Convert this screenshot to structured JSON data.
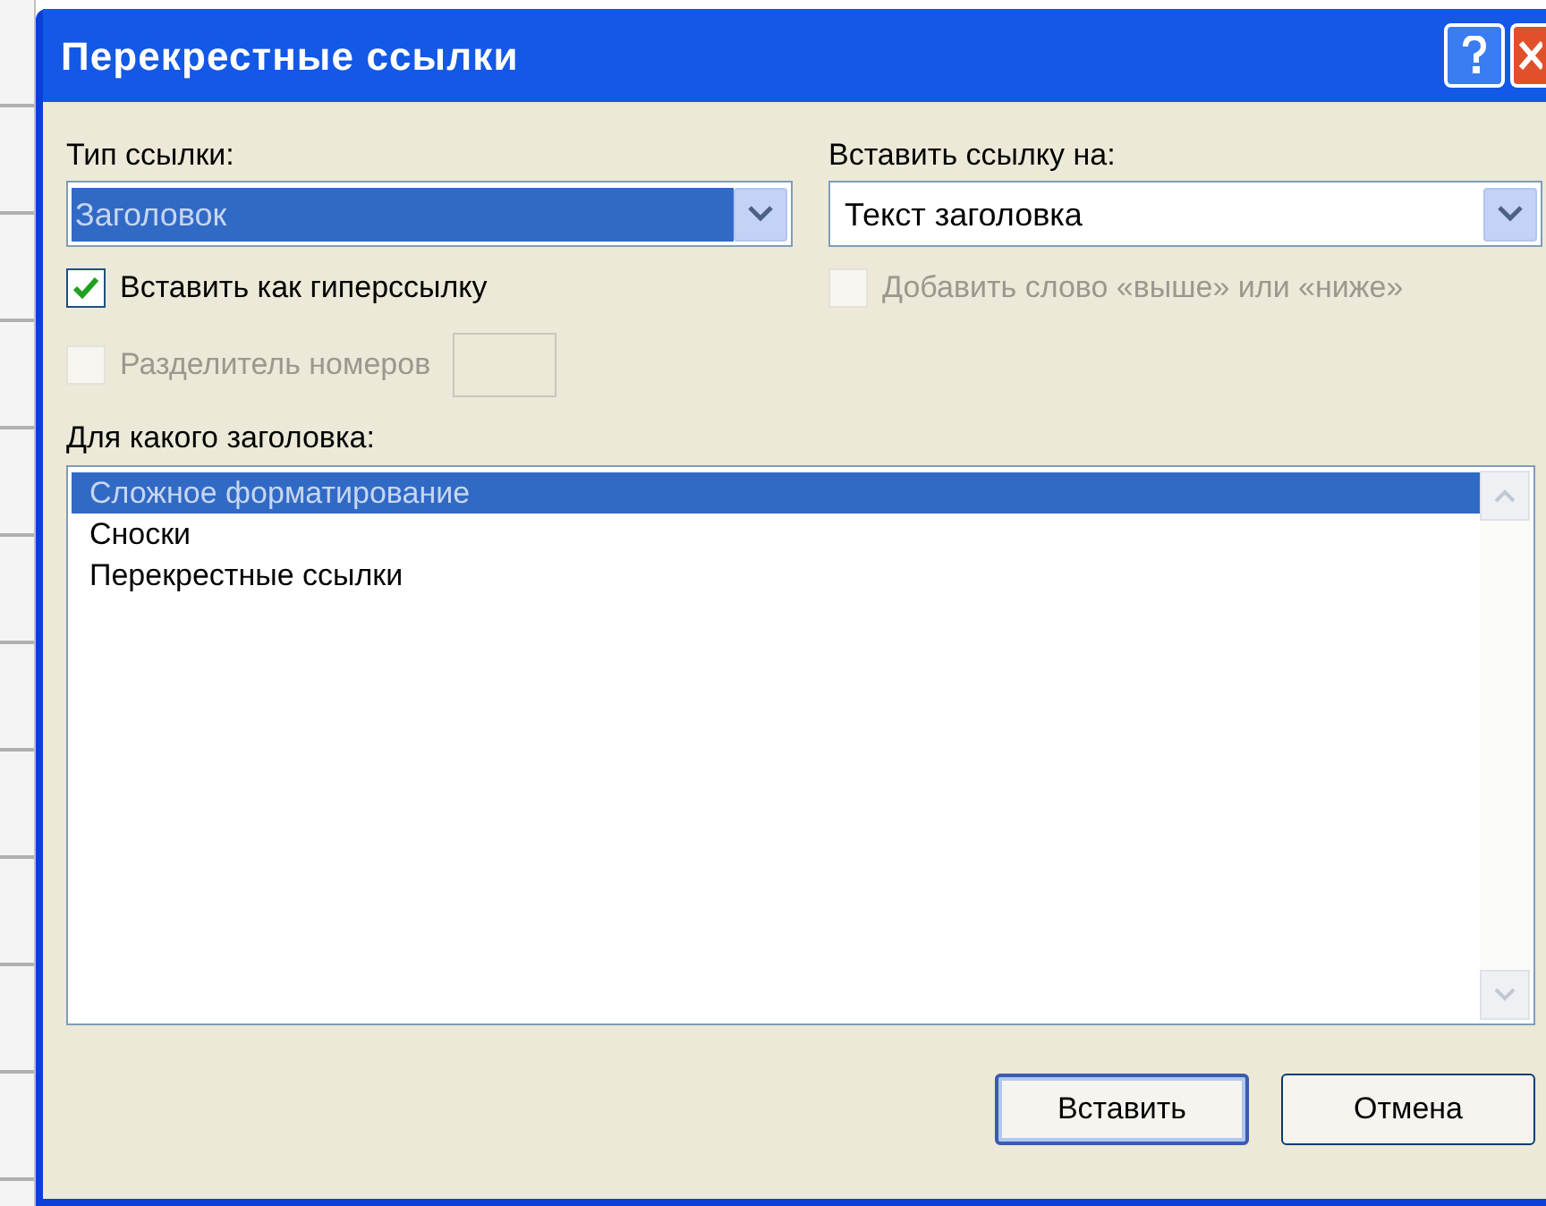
{
  "window": {
    "title": "Перекрестные ссылки"
  },
  "reference_type": {
    "label": "Тип ссылки:",
    "value": "Заголовок",
    "focused": true
  },
  "insert_reference_to": {
    "label": "Вставить ссылку на:",
    "value": "Текст заголовка"
  },
  "checkboxes": [
    {
      "label": "Вставить как гиперссылку",
      "checked": true,
      "disabled": false
    },
    {
      "label": "Добавить слово «выше» или «ниже»",
      "checked": false,
      "disabled": true
    },
    {
      "label": "Разделитель номеров",
      "checked": false,
      "disabled": true
    }
  ],
  "for_which_heading": {
    "label": "Для какого заголовка:",
    "items": [
      {
        "text": "Сложное форматирование",
        "selected": true
      },
      {
        "text": "Сноски",
        "selected": false
      },
      {
        "text": "Перекрестные ссылки",
        "selected": false
      }
    ]
  },
  "buttons": [
    {
      "label": "Вставить",
      "default": true
    },
    {
      "label": "Отмена",
      "default": false
    }
  ]
}
